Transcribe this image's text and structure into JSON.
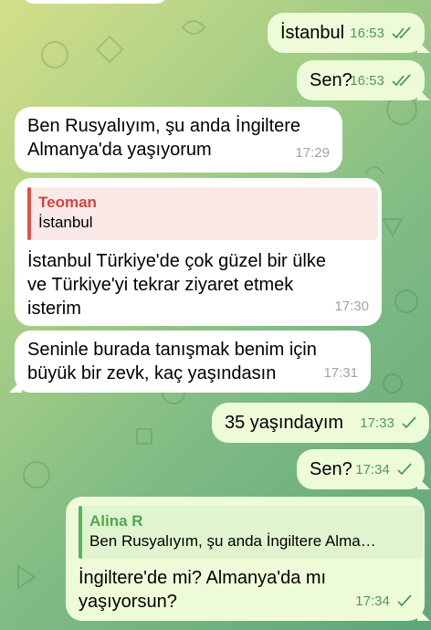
{
  "chat": {
    "messages": [
      {
        "text": "İstanbul",
        "time": "16:53",
        "outgoing": true
      },
      {
        "text": "Sen?",
        "time": "16:53",
        "outgoing": true
      },
      {
        "text": "Ben Rusyalıyım, şu anda İngiltere\nAlmanya'da yaşıyorum",
        "time": "17:29",
        "outgoing": false
      },
      {
        "reply_name": "Teoman",
        "reply_text": "İstanbul",
        "text": "İstanbul Türkiye'de çok güzel bir ülke\nve Türkiye'yi tekrar ziyaret etmek\nisterim",
        "time": "17:30",
        "outgoing": false
      },
      {
        "text": "Seninle burada tanışmak benim için\nbüyük bir zevk, kaç yaşındasın",
        "time": "17:31",
        "outgoing": false
      },
      {
        "text": "35 yaşındayım",
        "time": "17:33",
        "outgoing": true
      },
      {
        "text": "Sen?",
        "time": "17:34",
        "outgoing": true
      },
      {
        "reply_name": "Alina R",
        "reply_text": "Ben Rusyalıyım, şu anda İngiltere Alma…",
        "text": "İngiltere'de mi? Almanya'da mı\nyaşıyorsun?",
        "time": "17:34",
        "outgoing": true
      }
    ]
  },
  "icons": {
    "read_status": "double-check-icon",
    "sent_status": "single-check-icon"
  },
  "colors": {
    "outgoing_bubble": "#eefbd9",
    "incoming_bubble": "#ffffff",
    "outgoing_time": "#4f9a55",
    "reply_red": "#d9534f",
    "reply_green": "#58b35a"
  }
}
